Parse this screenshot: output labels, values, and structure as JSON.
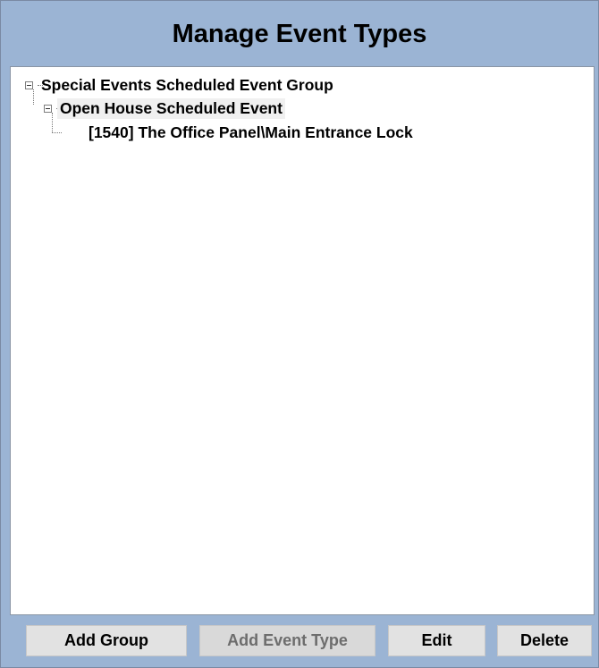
{
  "window": {
    "title": "Manage Event Types"
  },
  "tree": {
    "group": {
      "label": "Special Events Scheduled Event Group",
      "expanded": true
    },
    "event": {
      "label": "Open House Scheduled Event",
      "expanded": true,
      "selected": true
    },
    "item": {
      "label": "[1540] The Office Panel\\Main Entrance Lock"
    }
  },
  "buttons": {
    "add_group": "Add Group",
    "add_event_type": "Add Event Type",
    "edit": "Edit",
    "delete": "Delete"
  },
  "colors": {
    "window_background": "#9bb4d4",
    "tree_background": "#ffffff",
    "button_background": "#e2e2e2",
    "disabled_text": "#6d6d6d"
  }
}
